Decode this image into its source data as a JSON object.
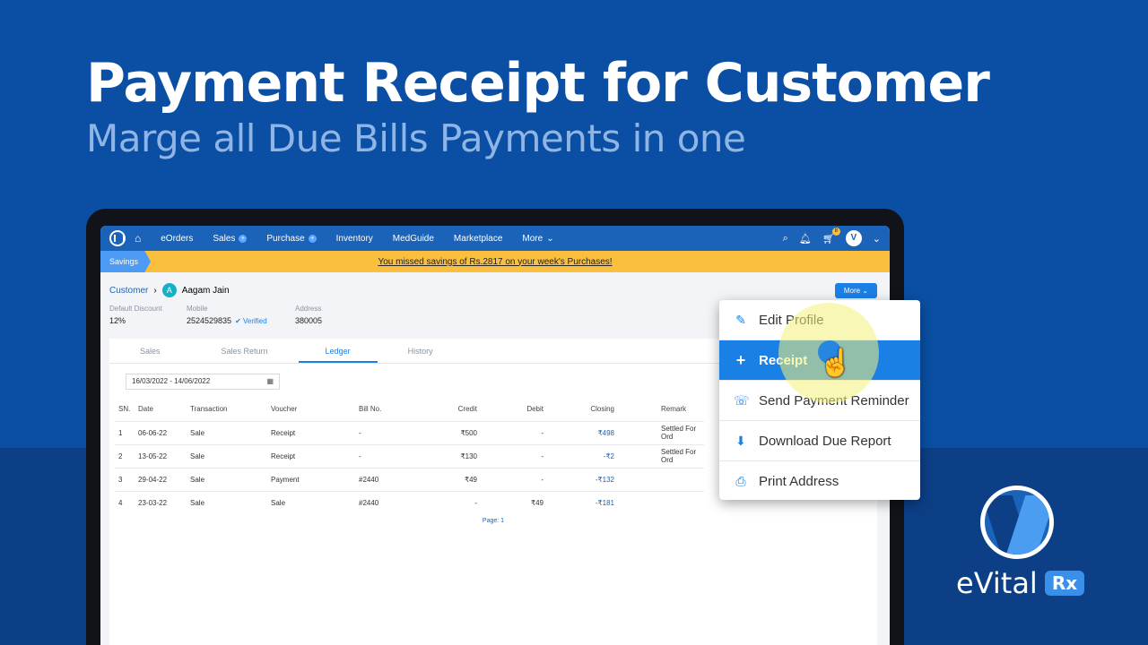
{
  "headline": "Payment Receipt for Customer",
  "subheadline": "Marge all Due Bills Payments in one",
  "navbar": {
    "items": [
      {
        "label": "eOrders",
        "badge": false
      },
      {
        "label": "Sales",
        "badge": true
      },
      {
        "label": "Purchase",
        "badge": true
      },
      {
        "label": "Inventory",
        "badge": false
      },
      {
        "label": "MedGuide",
        "badge": false
      },
      {
        "label": "Marketplace",
        "badge": false
      },
      {
        "label": "More",
        "badge": false
      }
    ],
    "cart_count": "8",
    "icons": [
      "home-icon",
      "search-icon",
      "bell-icon",
      "cart-icon",
      "avatar"
    ]
  },
  "savings": {
    "tag": "Savings",
    "message": "You missed savings of Rs.2817 on your week's Purchases!"
  },
  "customer": {
    "breadcrumb_root": "Customer",
    "avatar_letter": "A",
    "name": "Aagam Jain",
    "more_label": "More",
    "discount_label": "Default Discount",
    "discount_value": "12%",
    "mobile_label": "Mobile",
    "mobile_value": "2524529835",
    "verified_label": "Verified",
    "address_label": "Address",
    "address_value": "380005"
  },
  "tabs": [
    "Sales",
    "Sales Return",
    "Ledger",
    "History"
  ],
  "active_tab": "Ledger",
  "date_range": "16/03/2022 - 14/06/2022",
  "ledger": {
    "headers": [
      "SN.",
      "Date",
      "Transaction",
      "Voucher",
      "Bill No.",
      "Credit",
      "Debit",
      "Closing",
      "Remark"
    ],
    "rows": [
      [
        "1",
        "06-06-22",
        "Sale",
        "Receipt",
        "-",
        "₹500",
        "-",
        "₹498",
        "Settled For Ord"
      ],
      [
        "2",
        "13-05-22",
        "Sale",
        "Receipt",
        "-",
        "₹130",
        "-",
        "-₹2",
        "Settled For Ord"
      ],
      [
        "3",
        "29-04-22",
        "Sale",
        "Payment",
        "#2440",
        "₹49",
        "-",
        "-₹132",
        ""
      ],
      [
        "4",
        "23-03-22",
        "Sale",
        "Sale",
        "#2440",
        "-",
        "₹49",
        "-₹181",
        ""
      ]
    ],
    "page_label": "Page: 1"
  },
  "dropdown": {
    "items": [
      {
        "label": "Edit Profile",
        "icon": "pencil-icon",
        "glyph": "✎"
      },
      {
        "label": "Receipt",
        "icon": "plus-icon",
        "glyph": "+"
      },
      {
        "label": "Send Payment Reminder",
        "icon": "whatsapp-icon",
        "glyph": "☏"
      },
      {
        "label": "Download Due Report",
        "icon": "download-icon",
        "glyph": "⬇"
      },
      {
        "label": "Print Address",
        "icon": "printer-icon",
        "glyph": "⎙"
      }
    ],
    "active_index": 1
  },
  "brand": {
    "name": "eVital",
    "suffix": "Rx"
  },
  "colors": {
    "background": "#0a4fa3",
    "navbar": "#1b63b8",
    "accent": "#1b80e6",
    "savings_bar": "#fbbf3f"
  }
}
